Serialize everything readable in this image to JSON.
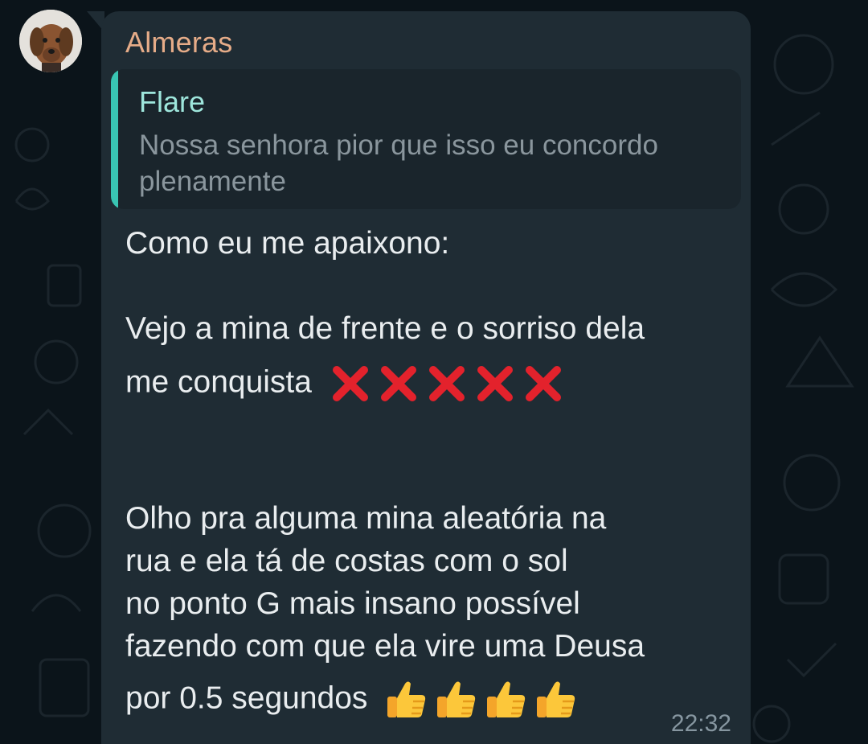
{
  "chat": {
    "sender_name": "Almeras",
    "quoted": {
      "author": "Flare",
      "text": "Nossa senhora pior que isso eu concordo plenamente"
    },
    "message_lines": [
      "Como eu me apaixono:",
      "Vejo a mina de frente e o sorriso dela",
      "me conquista",
      "Olho pra alguma mina aleatória na",
      "rua e ela tá de costas com o sol",
      "no ponto G mais insano possível",
      "fazendo com que ela vire uma Deusa",
      "por 0.5 segundos"
    ],
    "emoji_groups": {
      "cross_mark_count": 5,
      "thumbs_up_count": 4
    },
    "timestamp": "22:32"
  },
  "colors": {
    "wallpaper": "#0b141a",
    "bubble": "#1f2c34",
    "sender_name": "#e6ac88",
    "quote_bar": "#39c5b3",
    "quote_author": "#9ee6dc"
  }
}
